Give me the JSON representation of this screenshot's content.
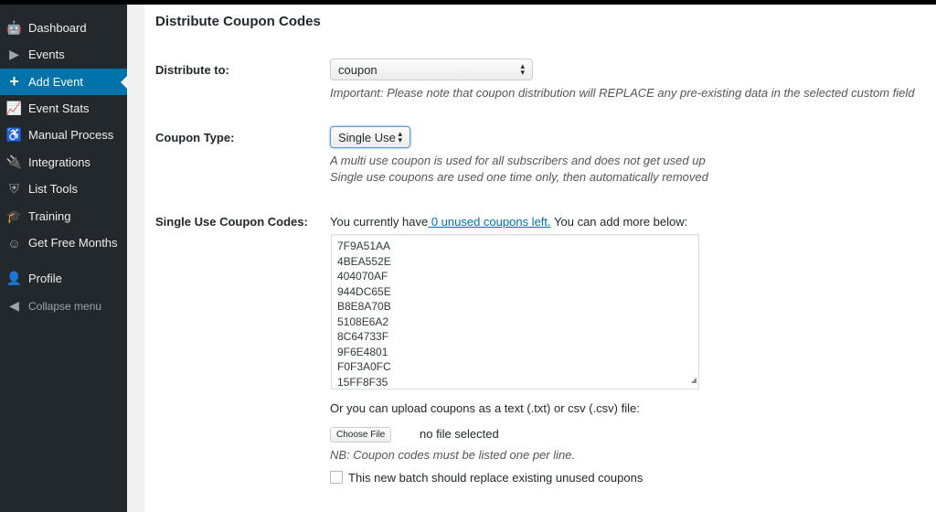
{
  "sidebar": {
    "items": [
      {
        "label": "Dashboard",
        "icon": "robot-icon"
      },
      {
        "label": "Events",
        "icon": "play-icon"
      },
      {
        "label": "Add Event",
        "icon": "plus-icon",
        "active": true
      },
      {
        "label": "Event Stats",
        "icon": "chart-icon"
      },
      {
        "label": "Manual Process",
        "icon": "accessibility-icon"
      },
      {
        "label": "Integrations",
        "icon": "plug-icon"
      },
      {
        "label": "List Tools",
        "icon": "shield-icon"
      },
      {
        "label": "Training",
        "icon": "graduation-cap-icon"
      },
      {
        "label": "Get Free Months",
        "icon": "smiley-icon"
      },
      {
        "label": "Profile",
        "icon": "user-icon"
      },
      {
        "label": "Collapse menu",
        "icon": "collapse-icon"
      }
    ],
    "accent": "#0073aa",
    "background": "#23282d"
  },
  "main": {
    "title": "Distribute Coupon Codes",
    "distribute": {
      "label": "Distribute to:",
      "value": "coupon",
      "note": "Important: Please note that coupon distribution will REPLACE any pre-existing data in the selected custom field"
    },
    "coupon_type": {
      "label": "Coupon Type:",
      "value": "Single Use",
      "note1": "A multi use coupon is used for all subscribers and does not get used up",
      "note2": "Single use coupons are used one time only, then automatically removed"
    },
    "codes": {
      "label": "Single Use Coupon Codes:",
      "prefix": "You currently have",
      "link": " 0 unused coupons left.",
      "suffix": " You can add more below:",
      "values": [
        "7F9A51AA",
        "4BEA552E",
        "404070AF",
        "944DC65E",
        "B8E8A70B",
        "5108E6A2",
        "8C64733F",
        "9F6E4801",
        "F0F3A0FC",
        "15FF8F35"
      ]
    },
    "upload": {
      "text": "Or you can upload coupons as a text (.txt) or csv (.csv) file:",
      "button": "Choose File",
      "status": "no file selected",
      "note": "NB: Coupon codes must be listed one per line."
    },
    "replace": {
      "label": "This new batch should replace existing unused coupons",
      "checked": false
    }
  }
}
